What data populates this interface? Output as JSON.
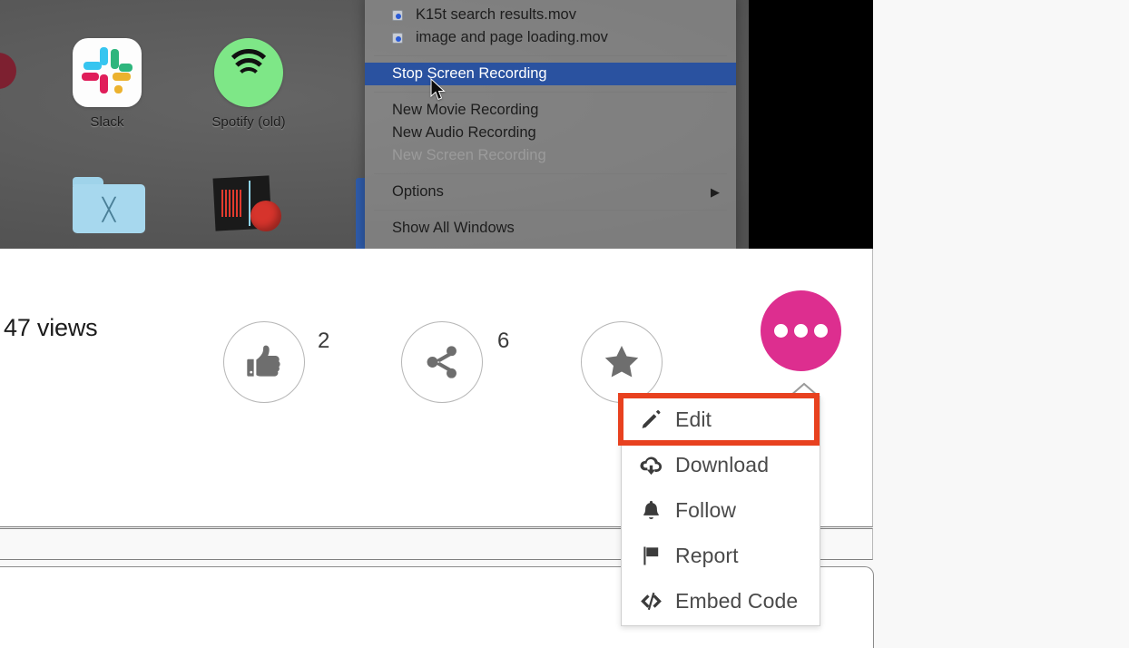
{
  "desktop": {
    "apps": [
      {
        "label": "Slack",
        "icon": "slack-icon"
      },
      {
        "label": "Spotify (old)",
        "icon": "spotify-icon"
      },
      {
        "label": "",
        "icon": "utilities-folder-icon"
      },
      {
        "label": "",
        "icon": "audacity-icon"
      }
    ]
  },
  "mac_menu": {
    "recent_files": [
      {
        "label": "K15t search results.mov",
        "icon": "quicktime-document-icon"
      },
      {
        "label": "image and page loading.mov",
        "icon": "quicktime-document-icon"
      }
    ],
    "items": [
      {
        "label": "Stop Screen Recording",
        "state": "selected"
      },
      {
        "label": "New Movie Recording",
        "state": "normal"
      },
      {
        "label": "New Audio Recording",
        "state": "normal"
      },
      {
        "label": "New Screen Recording",
        "state": "disabled"
      },
      {
        "label": "Options",
        "state": "submenu",
        "submenu_icon": "triangle-right-icon"
      },
      {
        "label": "Show All Windows",
        "state": "normal"
      }
    ]
  },
  "action_bar": {
    "views_label": "47 views",
    "like": {
      "icon": "thumbs-up-icon",
      "count": "2"
    },
    "share": {
      "icon": "share-icon",
      "count": "6"
    },
    "favorite": {
      "icon": "star-icon"
    },
    "more": {
      "icon": "ellipsis-icon",
      "color": "#dd2e8f"
    }
  },
  "dropdown": {
    "items": [
      {
        "label": "Edit",
        "icon": "pencil-icon",
        "highlighted": true
      },
      {
        "label": "Download",
        "icon": "cloud-download-icon",
        "highlighted": false
      },
      {
        "label": "Follow",
        "icon": "bell-icon",
        "highlighted": false
      },
      {
        "label": "Report",
        "icon": "flag-icon",
        "highlighted": false
      },
      {
        "label": "Embed Code",
        "icon": "code-icon",
        "highlighted": false
      }
    ],
    "highlight_color": "#e8411f"
  }
}
